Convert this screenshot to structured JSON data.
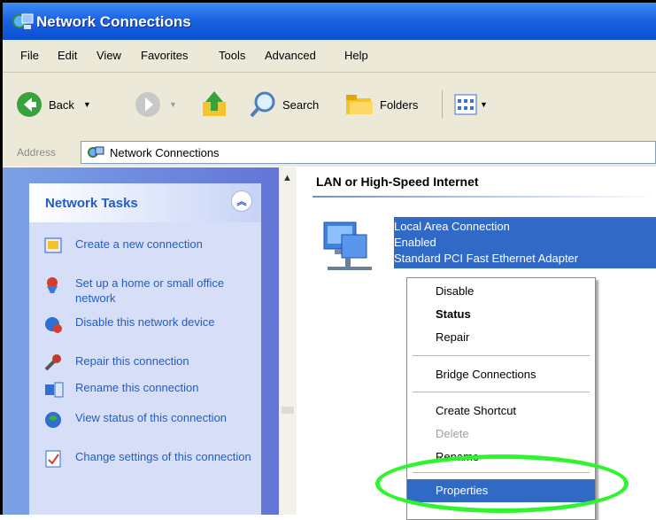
{
  "window": {
    "title": "Network Connections"
  },
  "menu": [
    "File",
    "Edit",
    "View",
    "Favorites",
    "Tools",
    "Advanced",
    "Help"
  ],
  "toolbar": {
    "back": "Back",
    "search": "Search",
    "folders": "Folders"
  },
  "address": {
    "label": "Address",
    "value": "Network Connections"
  },
  "tasks": {
    "title": "Network Tasks",
    "items": [
      {
        "text": "Create a new connection",
        "icon": "create-connection-icon"
      },
      {
        "text": "Set up a home or small office network",
        "icon": "home-network-icon"
      },
      {
        "text": "Disable this network device",
        "icon": "disable-device-icon"
      },
      {
        "text": "Repair this connection",
        "icon": "repair-icon"
      },
      {
        "text": "Rename this connection",
        "icon": "rename-icon"
      },
      {
        "text": "View status of this connection",
        "icon": "status-icon"
      },
      {
        "text": "Change settings of this connection",
        "icon": "settings-icon"
      }
    ]
  },
  "group": {
    "title": "LAN or High-Speed Internet"
  },
  "connection": {
    "name": "Local Area Connection",
    "status": "Enabled",
    "device": "Standard PCI Fast Ethernet Adapter"
  },
  "context_menu": {
    "items": [
      "Disable",
      "Status",
      "Repair",
      "Bridge Connections",
      "Create Shortcut",
      "Delete",
      "Rename",
      "Properties"
    ],
    "bold": "Status",
    "disabled": "Delete",
    "selected": "Properties"
  },
  "colors": {
    "title_bar": "#1d63e0",
    "selection": "#316ac5",
    "annotation": "#2ef52e"
  }
}
